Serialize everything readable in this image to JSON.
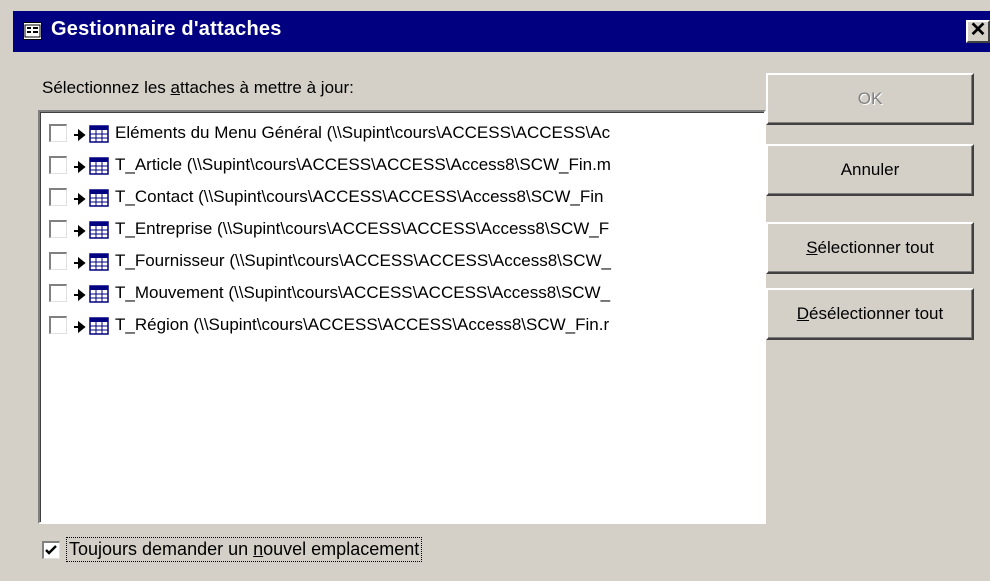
{
  "window": {
    "title": "Gestionnaire d'attaches",
    "close_glyph": "✕"
  },
  "list": {
    "prompt_before": "Sélectionnez les ",
    "prompt_underlined": "a",
    "prompt_after": "ttaches à mettre à jour:",
    "items": [
      {
        "label": "Eléments du Menu Général   (\\\\Supint\\cours\\ACCESS\\ACCESS\\Ac",
        "checked": false
      },
      {
        "label": "T_Article   (\\\\Supint\\cours\\ACCESS\\ACCESS\\Access8\\SCW_Fin.m",
        "checked": false
      },
      {
        "label": "T_Contact   (\\\\Supint\\cours\\ACCESS\\ACCESS\\Access8\\SCW_Fin",
        "checked": false
      },
      {
        "label": "T_Entreprise   (\\\\Supint\\cours\\ACCESS\\ACCESS\\Access8\\SCW_F",
        "checked": false
      },
      {
        "label": "T_Fournisseur   (\\\\Supint\\cours\\ACCESS\\ACCESS\\Access8\\SCW_",
        "checked": false
      },
      {
        "label": "T_Mouvement   (\\\\Supint\\cours\\ACCESS\\ACCESS\\Access8\\SCW_",
        "checked": false
      },
      {
        "label": "T_Région   (\\\\Supint\\cours\\ACCESS\\ACCESS\\Access8\\SCW_Fin.r",
        "checked": false
      }
    ]
  },
  "buttons": {
    "ok": "OK",
    "cancel": "Annuler",
    "select_all_underlined": "S",
    "select_all_rest": "électionner tout",
    "deselect_all_underlined": "D",
    "deselect_all_rest": "ésélectionner tout"
  },
  "footer": {
    "checkbox_checked": true,
    "label_before": "Toujours demander un ",
    "label_underlined": "n",
    "label_after": "ouvel emplacement"
  },
  "icons": {
    "window": "form-icon",
    "row_arrow": "link-arrow-icon",
    "row_table": "table-icon"
  }
}
